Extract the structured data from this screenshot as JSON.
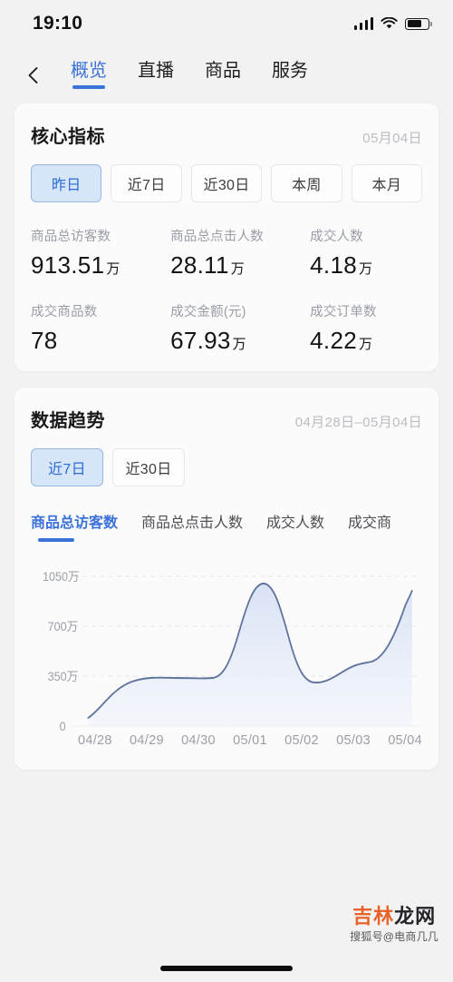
{
  "statusbar": {
    "time": "19:10",
    "signal_icon": "cellular-bars-icon",
    "wifi_icon": "wifi-icon",
    "battery_icon": "battery-icon"
  },
  "navbar": {
    "back_icon": "back-chevron-icon",
    "tabs": [
      {
        "label": "概览",
        "active": true
      },
      {
        "label": "直播",
        "active": false
      },
      {
        "label": "商品",
        "active": false
      },
      {
        "label": "服务",
        "active": false
      }
    ]
  },
  "core_metrics_card": {
    "title": "核心指标",
    "date": "05月04日",
    "range_chips": [
      {
        "label": "昨日",
        "active": true
      },
      {
        "label": "近7日",
        "active": false
      },
      {
        "label": "近30日",
        "active": false
      },
      {
        "label": "本周",
        "active": false
      },
      {
        "label": "本月",
        "active": false
      }
    ],
    "metrics": [
      {
        "label": "商品总访客数",
        "value": "913.51",
        "unit": "万"
      },
      {
        "label": "商品总点击人数",
        "value": "28.11",
        "unit": "万"
      },
      {
        "label": "成交人数",
        "value": "4.18",
        "unit": "万"
      },
      {
        "label": "成交商品数",
        "value": "78",
        "unit": ""
      },
      {
        "label": "成交金额(元)",
        "value": "67.93",
        "unit": "万"
      },
      {
        "label": "成交订单数",
        "value": "4.22",
        "unit": "万"
      }
    ]
  },
  "trend_card": {
    "title": "数据趋势",
    "date_range": "04月28日–05月04日",
    "range_chips": [
      {
        "label": "近7日",
        "active": true
      },
      {
        "label": "近30日",
        "active": false
      }
    ],
    "metric_tabs": [
      {
        "label": "商品总访客数",
        "active": true
      },
      {
        "label": "商品总点击人数",
        "active": false
      },
      {
        "label": "成交人数",
        "active": false
      },
      {
        "label": "成交商",
        "active": false
      }
    ]
  },
  "chart_data": {
    "type": "area",
    "title": "商品总访客数",
    "xlabel": "",
    "ylabel": "",
    "categories": [
      "04/28",
      "04/29",
      "04/30",
      "05/01",
      "05/02",
      "05/03",
      "05/04"
    ],
    "values": [
      55,
      285,
      280,
      930,
      275,
      390,
      880
    ],
    "y_ticks": [
      "0",
      "350万",
      "700万",
      "1050万"
    ],
    "y_tick_values": [
      0,
      350,
      700,
      1050
    ],
    "ylim": [
      0,
      1050
    ],
    "unit": "万",
    "grid": true,
    "legend": "none",
    "line_color": "#5f739c",
    "fill_color": "#dfe7f7",
    "smooth": true
  },
  "brand_watermark": {
    "main_orange": "吉林",
    "main_dark": "龙网",
    "sub": "搜狐号@电商几几"
  },
  "colors": {
    "accent": "#3b72d9",
    "chip_active_bg": "#d7e5f8",
    "chip_active_text": "#2b6cd4",
    "page_bg": "#f2f2f2",
    "card_bg": "#fbfbfc",
    "label_gray": "#9a9ea6"
  }
}
